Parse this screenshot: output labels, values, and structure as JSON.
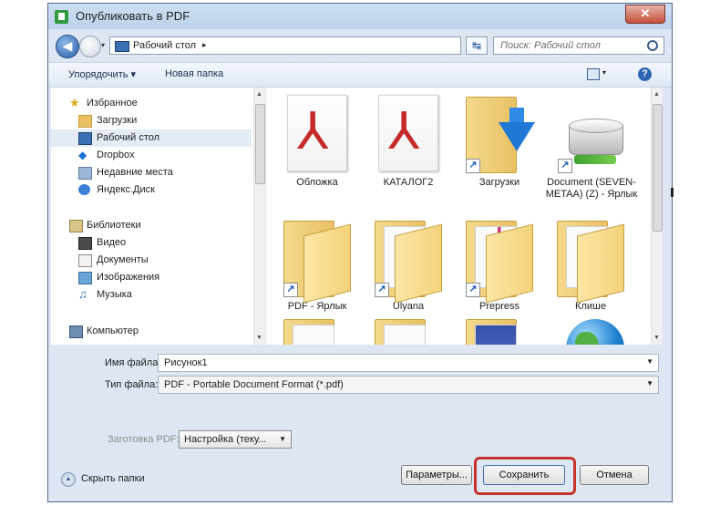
{
  "window": {
    "title": "Опубликовать в PDF",
    "close_glyph": "✕"
  },
  "address": {
    "location": "Рабочий стол",
    "arrow": "▸",
    "history_arrow": "▾"
  },
  "search": {
    "placeholder": "Поиск: Рабочий стол"
  },
  "toolbar": {
    "organize": "Упорядочить ▾",
    "new_folder": "Новая папка",
    "view_caret": "▾",
    "help": "?"
  },
  "nav": {
    "groups": [
      {
        "label": "Избранное",
        "icon": "star-icon"
      },
      {
        "label": "Библиотеки",
        "icon": "library-icon"
      },
      {
        "label": "Компьютер",
        "icon": "computer-icon"
      }
    ],
    "favorites": [
      {
        "label": "Загрузки",
        "icon": "downloads-icon",
        "selected": false
      },
      {
        "label": "Рабочий стол",
        "icon": "desktop-icon",
        "selected": true
      },
      {
        "label": "Dropbox",
        "icon": "dropbox-icon",
        "selected": false
      },
      {
        "label": "Недавние места",
        "icon": "recent-places-icon",
        "selected": false
      },
      {
        "label": "Яндекс.Диск",
        "icon": "yandex-disk-icon",
        "selected": false
      }
    ],
    "libraries": [
      {
        "label": "Видео",
        "icon": "video-icon"
      },
      {
        "label": "Документы",
        "icon": "documents-icon"
      },
      {
        "label": "Изображения",
        "icon": "pictures-icon"
      },
      {
        "label": "Музыка",
        "icon": "music-icon"
      }
    ]
  },
  "files": [
    {
      "label": "Обложка",
      "icon": "pdf-file-icon",
      "shortcut": false
    },
    {
      "label": "КАТАЛОГ2",
      "icon": "pdf-file-icon",
      "shortcut": false
    },
    {
      "label": "Загрузки",
      "icon": "downloads-folder-icon",
      "shortcut": true
    },
    {
      "label": "Document (SEVEN-METAA) (Z) - Ярлык",
      "icon": "network-drive-icon",
      "shortcut": true
    },
    {
      "label": "PDF - Ярлык",
      "icon": "folder-icon",
      "shortcut": true
    },
    {
      "label": "Ulyana",
      "icon": "folder-icon",
      "shortcut": true
    },
    {
      "label": "Prepress",
      "icon": "folder-icon",
      "shortcut": true
    },
    {
      "label": "Клише",
      "icon": "folder-icon",
      "shortcut": false
    },
    {
      "label": "",
      "icon": "folder-icon",
      "shortcut": false
    },
    {
      "label": "",
      "icon": "folder-icon",
      "shortcut": false
    },
    {
      "label": "",
      "icon": "folder-icon",
      "shortcut": false
    },
    {
      "label": "",
      "icon": "globe-icon",
      "shortcut": false
    }
  ],
  "form": {
    "filename_label": "Имя файла:",
    "filename_value": "Рисунок1",
    "filetype_label": "Тип файла:",
    "filetype_value": "PDF - Portable Document Format (*.pdf)",
    "preset_label": "Заготовка PDF:",
    "preset_value": "Настройка (теку..."
  },
  "footer": {
    "hide_folders": "Скрыть папки",
    "params_button": "Параметры...",
    "save_button": "Сохранить",
    "cancel_button": "Отмена"
  },
  "colors": {
    "highlight_frame": "#c7332c",
    "selected_nav": "#e3ebf5",
    "pdf_red": "#c62a2a"
  }
}
